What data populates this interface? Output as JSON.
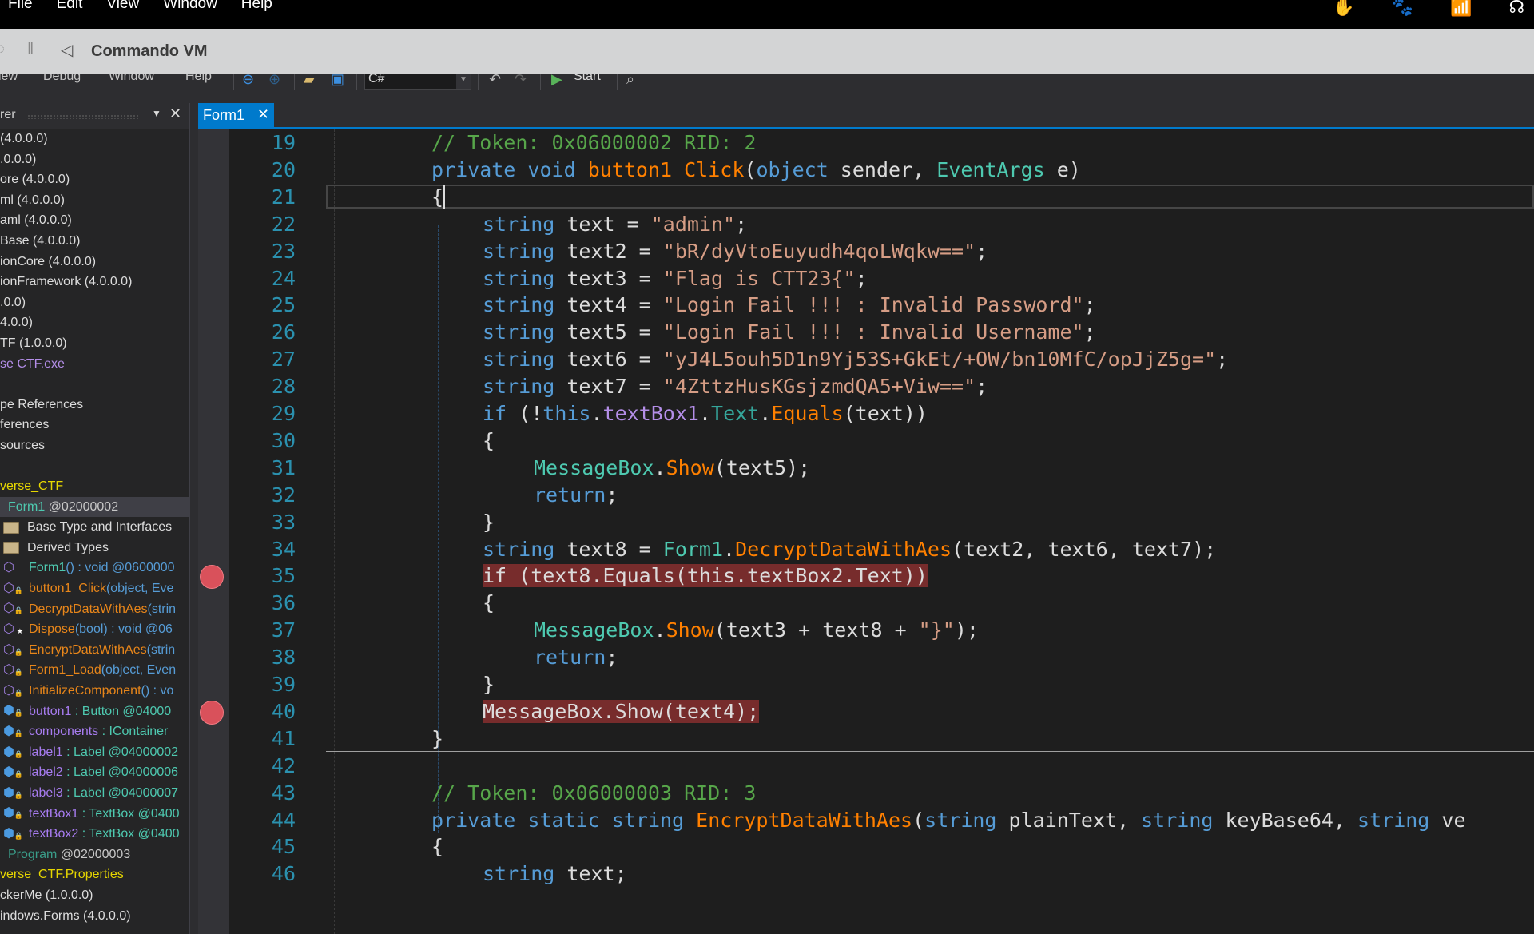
{
  "os_menubar": {
    "items": [
      "File",
      "Edit",
      "View",
      "Window",
      "Help"
    ],
    "tray_icons": [
      "hand-icon",
      "fox-icon",
      "wifi-lock-icon",
      "headset-icon"
    ]
  },
  "vm_window": {
    "title": "Commando VM",
    "controls": [
      "power-icon",
      "pause-icon",
      "back-icon"
    ]
  },
  "ide": {
    "menu": [
      "iew",
      "Debug",
      "Window",
      "Help"
    ],
    "toolbar": {
      "language": "C#",
      "start_label": "Start"
    }
  },
  "explorer": {
    "title": "rer",
    "rows": [
      {
        "text": "(4.0.0.0)",
        "color": "white",
        "icon": ""
      },
      {
        "text": ".0.0.0)",
        "color": "white",
        "icon": ""
      },
      {
        "text": "ore (4.0.0.0)",
        "color": "white",
        "icon": ""
      },
      {
        "text": "ml (4.0.0.0)",
        "color": "white",
        "icon": ""
      },
      {
        "text": "aml (4.0.0.0)",
        "color": "white",
        "icon": ""
      },
      {
        "text": "Base (4.0.0.0)",
        "color": "white",
        "icon": ""
      },
      {
        "text": "ionCore (4.0.0.0)",
        "color": "white",
        "icon": ""
      },
      {
        "text": "ionFramework (4.0.0.0)",
        "color": "white",
        "icon": ""
      },
      {
        "text": ".0.0)",
        "color": "white",
        "icon": ""
      },
      {
        "text": "4.0.0)",
        "color": "white",
        "icon": ""
      },
      {
        "text": "TF (1.0.0.0)",
        "color": "white",
        "icon": ""
      },
      {
        "text": "se CTF.exe",
        "color": "purple",
        "icon": ""
      },
      {
        "text": "",
        "color": "white",
        "icon": ""
      },
      {
        "text": "pe References",
        "color": "white",
        "icon": ""
      },
      {
        "text": "ferences",
        "color": "white",
        "icon": ""
      },
      {
        "text": "sources",
        "color": "white",
        "icon": ""
      },
      {
        "text": "",
        "color": "white",
        "icon": ""
      },
      {
        "text": "verse_CTF",
        "color": "yellow",
        "icon": ""
      }
    ],
    "selected_class": {
      "name": "Form1",
      "token": "@02000002"
    },
    "members": [
      {
        "icon": "folder",
        "name": "Base Type and Interfaces",
        "rest": ""
      },
      {
        "icon": "folder",
        "name": "Derived Types",
        "rest": ""
      },
      {
        "icon": "method",
        "name": "Form1",
        "rest": "() : void @0600000"
      },
      {
        "icon": "method-private",
        "name": "button1_Click",
        "rest": "(object, Eve"
      },
      {
        "icon": "method-private",
        "name": "DecryptDataWithAes",
        "rest": "(strin"
      },
      {
        "icon": "method-protected",
        "name": "Dispose",
        "rest": "(bool) : void @06"
      },
      {
        "icon": "method-private",
        "name": "EncryptDataWithAes",
        "rest": "(strin"
      },
      {
        "icon": "method-private",
        "name": "Form1_Load",
        "rest": "(object, Even"
      },
      {
        "icon": "method-private",
        "name": "InitializeComponent",
        "rest": "() : vo"
      },
      {
        "icon": "field-private",
        "name": "button1",
        "rest": " : Button @04000"
      },
      {
        "icon": "field-private",
        "name": "components",
        "rest": " : IContainer"
      },
      {
        "icon": "field-private",
        "name": "label1",
        "rest": " : Label @04000002"
      },
      {
        "icon": "field-private",
        "name": "label2",
        "rest": " : Label @04000006"
      },
      {
        "icon": "field-private",
        "name": "label3",
        "rest": " : Label @04000007"
      },
      {
        "icon": "field-private",
        "name": "textBox1",
        "rest": " : TextBox @0400"
      },
      {
        "icon": "field-private",
        "name": "textBox2",
        "rest": " : TextBox @0400"
      }
    ],
    "program": {
      "name": "Program",
      "token": "@02000003"
    },
    "after_rows": [
      {
        "text": "verse_CTF.Properties",
        "color": "yellow"
      },
      {
        "text": "ckerMe (1.0.0.0)",
        "color": "white"
      },
      {
        "text": "indows.Forms (4.0.0.0)",
        "color": "white"
      }
    ]
  },
  "tab": {
    "label": "Form1"
  },
  "editor": {
    "lines": [
      {
        "n": "19",
        "indent": 0,
        "tokens": [
          [
            "cmt",
            "// Token: 0x06000002 RID: 2"
          ]
        ]
      },
      {
        "n": "20",
        "indent": 0,
        "tokens": [
          [
            "kw",
            "private"
          ],
          [
            "plain",
            " "
          ],
          [
            "kw",
            "void"
          ],
          [
            "plain",
            " "
          ],
          [
            "mth",
            "button1_Click"
          ],
          [
            "plain",
            "("
          ],
          [
            "kw",
            "object"
          ],
          [
            "plain",
            " sender, "
          ],
          [
            "typ",
            "EventArgs"
          ],
          [
            "plain",
            " e)"
          ]
        ]
      },
      {
        "n": "21",
        "indent": 0,
        "tokens": [
          [
            "plain",
            "{"
          ]
        ],
        "current": true
      },
      {
        "n": "22",
        "indent": 1,
        "tokens": [
          [
            "kw",
            "string"
          ],
          [
            "plain",
            " text = "
          ],
          [
            "str",
            "\"admin\""
          ],
          [
            "plain",
            ";"
          ]
        ]
      },
      {
        "n": "23",
        "indent": 1,
        "tokens": [
          [
            "kw",
            "string"
          ],
          [
            "plain",
            " text2 = "
          ],
          [
            "str",
            "\"bR/dyVtoEuyudh4qoLWqkw==\""
          ],
          [
            "plain",
            ";"
          ]
        ]
      },
      {
        "n": "24",
        "indent": 1,
        "tokens": [
          [
            "kw",
            "string"
          ],
          [
            "plain",
            " text3 = "
          ],
          [
            "str",
            "\"Flag is CTT23{\""
          ],
          [
            "plain",
            ";"
          ]
        ]
      },
      {
        "n": "25",
        "indent": 1,
        "tokens": [
          [
            "kw",
            "string"
          ],
          [
            "plain",
            " text4 = "
          ],
          [
            "str",
            "\"Login Fail !!! : Invalid Password\""
          ],
          [
            "plain",
            ";"
          ]
        ]
      },
      {
        "n": "26",
        "indent": 1,
        "tokens": [
          [
            "kw",
            "string"
          ],
          [
            "plain",
            " text5 = "
          ],
          [
            "str",
            "\"Login Fail !!! : Invalid Username\""
          ],
          [
            "plain",
            ";"
          ]
        ]
      },
      {
        "n": "27",
        "indent": 1,
        "tokens": [
          [
            "kw",
            "string"
          ],
          [
            "plain",
            " text6 = "
          ],
          [
            "str",
            "\"yJ4L5ouh5D1n9Yj53S+GkEt/+OW/bn10MfC/opJjZ5g=\""
          ],
          [
            "plain",
            ";"
          ]
        ]
      },
      {
        "n": "28",
        "indent": 1,
        "tokens": [
          [
            "kw",
            "string"
          ],
          [
            "plain",
            " text7 = "
          ],
          [
            "str",
            "\"4ZttzHusKGsjzmdQA5+Viw==\""
          ],
          [
            "plain",
            ";"
          ]
        ]
      },
      {
        "n": "29",
        "indent": 1,
        "tokens": [
          [
            "kw",
            "if"
          ],
          [
            "plain",
            " (!"
          ],
          [
            "kw",
            "this"
          ],
          [
            "plain",
            "."
          ],
          [
            "fld",
            "textBox1"
          ],
          [
            "plain",
            "."
          ],
          [
            "prop",
            "Text"
          ],
          [
            "plain",
            "."
          ],
          [
            "mth",
            "Equals"
          ],
          [
            "plain",
            "(text))"
          ]
        ]
      },
      {
        "n": "30",
        "indent": 1,
        "tokens": [
          [
            "plain",
            "{"
          ]
        ]
      },
      {
        "n": "31",
        "indent": 2,
        "tokens": [
          [
            "typ",
            "MessageBox"
          ],
          [
            "plain",
            "."
          ],
          [
            "mth",
            "Show"
          ],
          [
            "plain",
            "(text5);"
          ]
        ]
      },
      {
        "n": "32",
        "indent": 2,
        "tokens": [
          [
            "kw",
            "return"
          ],
          [
            "plain",
            ";"
          ]
        ]
      },
      {
        "n": "33",
        "indent": 1,
        "tokens": [
          [
            "plain",
            "}"
          ]
        ]
      },
      {
        "n": "34",
        "indent": 1,
        "tokens": [
          [
            "kw",
            "string"
          ],
          [
            "plain",
            " text8 = "
          ],
          [
            "typ",
            "Form1"
          ],
          [
            "plain",
            "."
          ],
          [
            "mth",
            "DecryptDataWithAes"
          ],
          [
            "plain",
            "(text2, text6, text7);"
          ]
        ]
      },
      {
        "n": "35",
        "indent": 1,
        "tokens": [
          [
            "plain",
            "if (text8.Equals(this.textBox2.Text))"
          ]
        ],
        "breakpoint": true
      },
      {
        "n": "36",
        "indent": 1,
        "tokens": [
          [
            "plain",
            "{"
          ]
        ]
      },
      {
        "n": "37",
        "indent": 2,
        "tokens": [
          [
            "typ",
            "MessageBox"
          ],
          [
            "plain",
            "."
          ],
          [
            "mth",
            "Show"
          ],
          [
            "plain",
            "(text3 + text8 + "
          ],
          [
            "str",
            "\"}\""
          ],
          [
            "plain",
            ");"
          ]
        ]
      },
      {
        "n": "38",
        "indent": 2,
        "tokens": [
          [
            "kw",
            "return"
          ],
          [
            "plain",
            ";"
          ]
        ]
      },
      {
        "n": "39",
        "indent": 1,
        "tokens": [
          [
            "plain",
            "}"
          ]
        ]
      },
      {
        "n": "40",
        "indent": 1,
        "tokens": [
          [
            "plain",
            "MessageBox.Show(text4);"
          ]
        ],
        "breakpoint": true
      },
      {
        "n": "41",
        "indent": 0,
        "tokens": [
          [
            "plain",
            "}"
          ]
        ],
        "separator_after": true
      },
      {
        "n": "42",
        "indent": 0,
        "tokens": []
      },
      {
        "n": "43",
        "indent": 0,
        "tokens": [
          [
            "cmt",
            "// Token: 0x06000003 RID: 3"
          ]
        ]
      },
      {
        "n": "44",
        "indent": 0,
        "tokens": [
          [
            "kw",
            "private"
          ],
          [
            "plain",
            " "
          ],
          [
            "kw",
            "static"
          ],
          [
            "plain",
            " "
          ],
          [
            "kw",
            "string"
          ],
          [
            "plain",
            " "
          ],
          [
            "mth",
            "EncryptDataWithAes"
          ],
          [
            "plain",
            "("
          ],
          [
            "kw",
            "string"
          ],
          [
            "plain",
            " plainText, "
          ],
          [
            "kw",
            "string"
          ],
          [
            "plain",
            " keyBase64, "
          ],
          [
            "kw",
            "string"
          ],
          [
            "plain",
            " ve"
          ]
        ]
      },
      {
        "n": "45",
        "indent": 0,
        "tokens": [
          [
            "plain",
            "{"
          ]
        ]
      },
      {
        "n": "46",
        "indent": 1,
        "tokens": [
          [
            "kw",
            "string"
          ],
          [
            "plain",
            " text;"
          ]
        ]
      }
    ]
  }
}
